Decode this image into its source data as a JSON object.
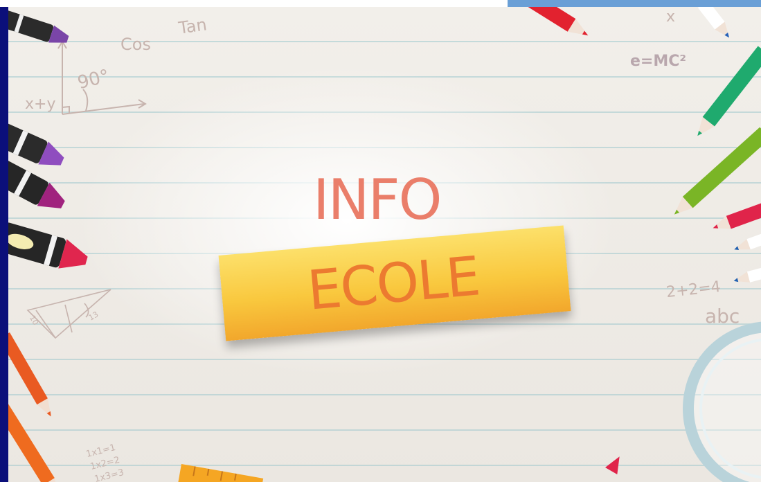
{
  "hero": {
    "line1": "INFO",
    "line2": "ECOLE"
  },
  "sketches": {
    "tan": "Tan",
    "cos": "Cos",
    "angle": "90°",
    "xy": "x+y",
    "emc": "e=MC²",
    "x": "x",
    "sum": "2+2=4",
    "abc": "abc",
    "mult1": "1x1=1",
    "mult2": "1x2=2",
    "mult3": "1x3=3",
    "tri_left": "10",
    "tri_right": "13"
  },
  "colors": {
    "frame": "#0b0f7a",
    "tab": "#6a9fd6",
    "info_text": "#ea7e6a",
    "ecole_text": "#ec7a30",
    "note": "#f9c83e"
  }
}
